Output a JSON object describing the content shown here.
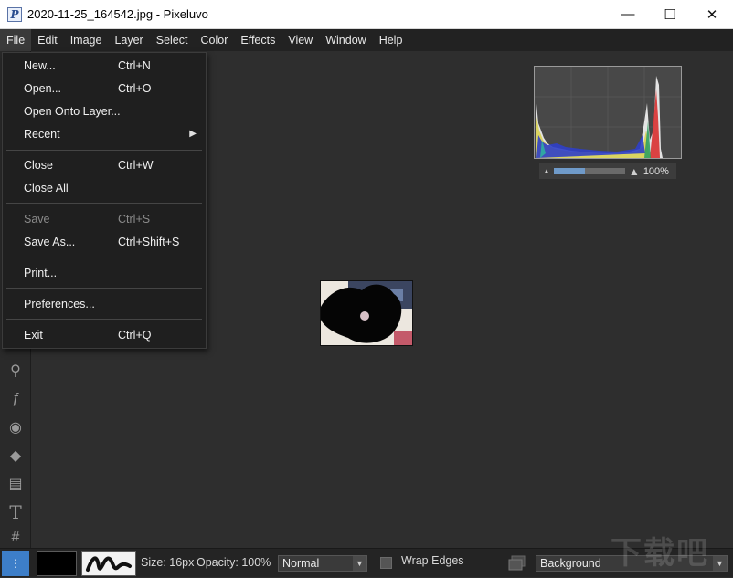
{
  "window": {
    "app_icon_letter": "P",
    "title": "2020-11-25_164542.jpg - Pixeluvo",
    "controls": {
      "minimize": "—",
      "maximize": "☐",
      "close": "✕"
    }
  },
  "menubar": {
    "items": [
      "File",
      "Edit",
      "Image",
      "Layer",
      "Select",
      "Color",
      "Effects",
      "View",
      "Window",
      "Help"
    ]
  },
  "file_menu": {
    "items": [
      {
        "label": "New...",
        "shortcut": "Ctrl+N",
        "disabled": false
      },
      {
        "label": "Open...",
        "shortcut": "Ctrl+O",
        "disabled": false
      },
      {
        "label": "Open Onto Layer...",
        "shortcut": "",
        "disabled": false
      },
      {
        "label": "Recent",
        "shortcut": "",
        "submenu": true,
        "disabled": false
      },
      {
        "label": "Close",
        "shortcut": "Ctrl+W",
        "disabled": false
      },
      {
        "label": "Close All",
        "shortcut": "",
        "disabled": false
      },
      {
        "label": "Save",
        "shortcut": "Ctrl+S",
        "disabled": true
      },
      {
        "label": "Save As...",
        "shortcut": "Ctrl+Shift+S",
        "disabled": false
      },
      {
        "label": "Print...",
        "shortcut": "",
        "disabled": false
      },
      {
        "label": "Preferences...",
        "shortcut": "",
        "disabled": false
      },
      {
        "label": "Exit",
        "shortcut": "Ctrl+Q",
        "disabled": false
      }
    ],
    "submenu_arrow": "▶"
  },
  "tools": [
    {
      "icon": "clone-brush-icon",
      "glyph": "⚲"
    },
    {
      "icon": "fx-brush-icon",
      "glyph": "ƒ"
    },
    {
      "icon": "red-eye-icon",
      "glyph": "◉"
    },
    {
      "icon": "paint-bucket-icon",
      "glyph": "◆"
    },
    {
      "icon": "gradient-icon",
      "glyph": "▤"
    },
    {
      "icon": "text-tool-icon",
      "glyph": "T"
    },
    {
      "icon": "crop-tool-icon",
      "glyph": "#"
    }
  ],
  "histogram": {
    "zoom_text": "100%",
    "slider_level_percent": 44
  },
  "bottom_bar": {
    "toggle_glyph": "⋮",
    "brush_size_text": "Size: 16px",
    "opacity_text": "Opacity: 100%",
    "blend_mode": "Normal",
    "wrap_edges_label": "Wrap Edges",
    "wrap_edges_checked": false,
    "layer_select": "Background",
    "caret": "▼"
  },
  "watermark_text": "下载吧",
  "colors": {
    "foreground_swatch": "#000000",
    "accent": "#3d7ec8"
  }
}
